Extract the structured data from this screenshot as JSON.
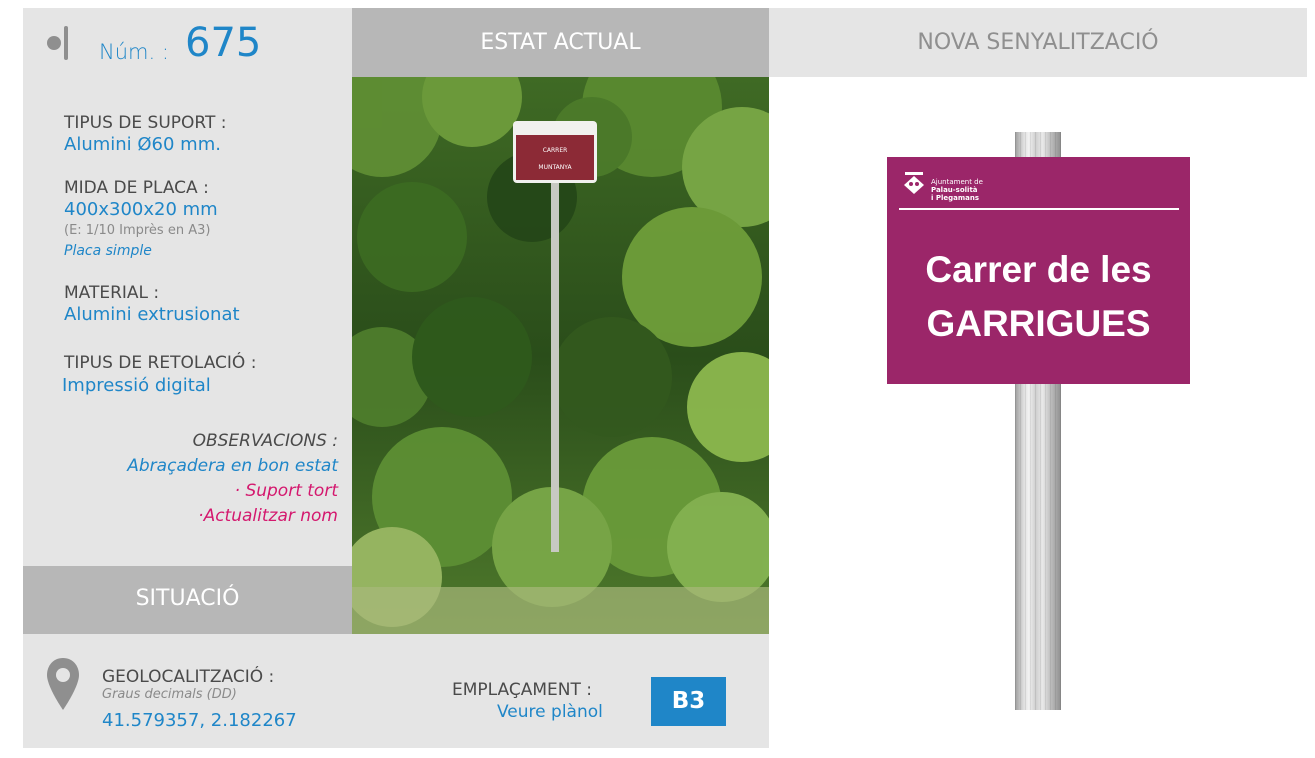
{
  "header": {
    "num_label": "Núm. :",
    "num_value": "675",
    "current_state_title": "ESTAT ACTUAL",
    "new_signage_title": "NOVA SENYALITZACIÓ"
  },
  "specs": {
    "support_label": "TIPUS DE SUPORT :",
    "support_value": "Alumini Ø60 mm.",
    "plate_size_label": "MIDA DE PLACA :",
    "plate_size_value": "400x300x20 mm",
    "plate_size_note": "(E: 1/10 Imprès en A3)",
    "plate_type": "Placa simple",
    "material_label": "MATERIAL :",
    "material_value": "Alumini extrusionat",
    "lettering_label": "TIPUS DE RETOLACIÓ :",
    "lettering_value": "Impressió digital"
  },
  "observations": {
    "label": "OBSERVACIONS :",
    "line1": "Abraçadera en bon estat",
    "line2": "· Suport tort",
    "line3": "·Actualitzar nom"
  },
  "situation": {
    "title": "SITUACIÓ",
    "geo_label": "GEOLOCALITZACIÓ :",
    "geo_format": "Graus decimals (DD)",
    "geo_value": "41.579357, 2.182267",
    "location_label": "EMPLAÇAMENT :",
    "location_link": "Veure plànol",
    "location_code": "B3"
  },
  "photo_sign": {
    "line1": "CARRER",
    "line2": "MUNTANYA"
  },
  "new_sign": {
    "logo_line1": "Ajuntament de",
    "logo_line2": "Palau-solità",
    "logo_line3": "i Plegamans",
    "street_line1": "Carrer de les",
    "street_line2": "GARRIGUES",
    "color": "#9b2669"
  },
  "colors": {
    "accent_blue": "#1f86c8",
    "accent_pink": "#d4186e",
    "panel_gray": "#e5e5e5",
    "header_gray": "#b7b7b7"
  }
}
